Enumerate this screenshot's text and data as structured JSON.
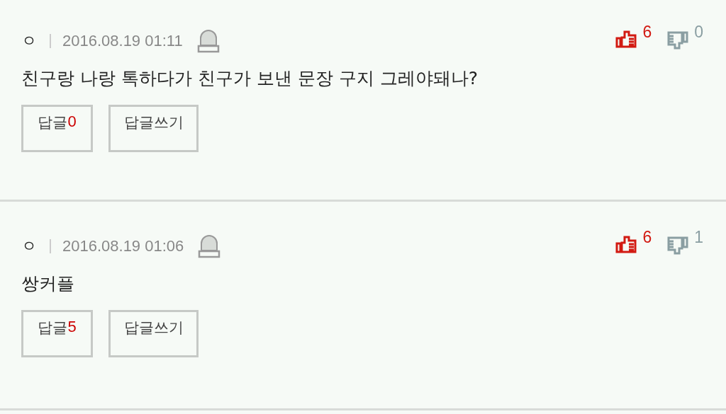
{
  "comments": [
    {
      "author": "ㅇ",
      "date": "2016.08.19 01:11",
      "likes": "6",
      "dislikes": "0",
      "text": "친구랑 나랑 톡하다가 친구가 보낸 문장 구지 그레야돼나?",
      "reply_label": "답글",
      "reply_count": "0",
      "write_reply": "답글쓰기"
    },
    {
      "author": "ㅇ",
      "date": "2016.08.19 01:06",
      "likes": "6",
      "dislikes": "1",
      "text": "쌍커플",
      "reply_label": "답글",
      "reply_count": "5",
      "write_reply": "답글쓰기"
    }
  ]
}
